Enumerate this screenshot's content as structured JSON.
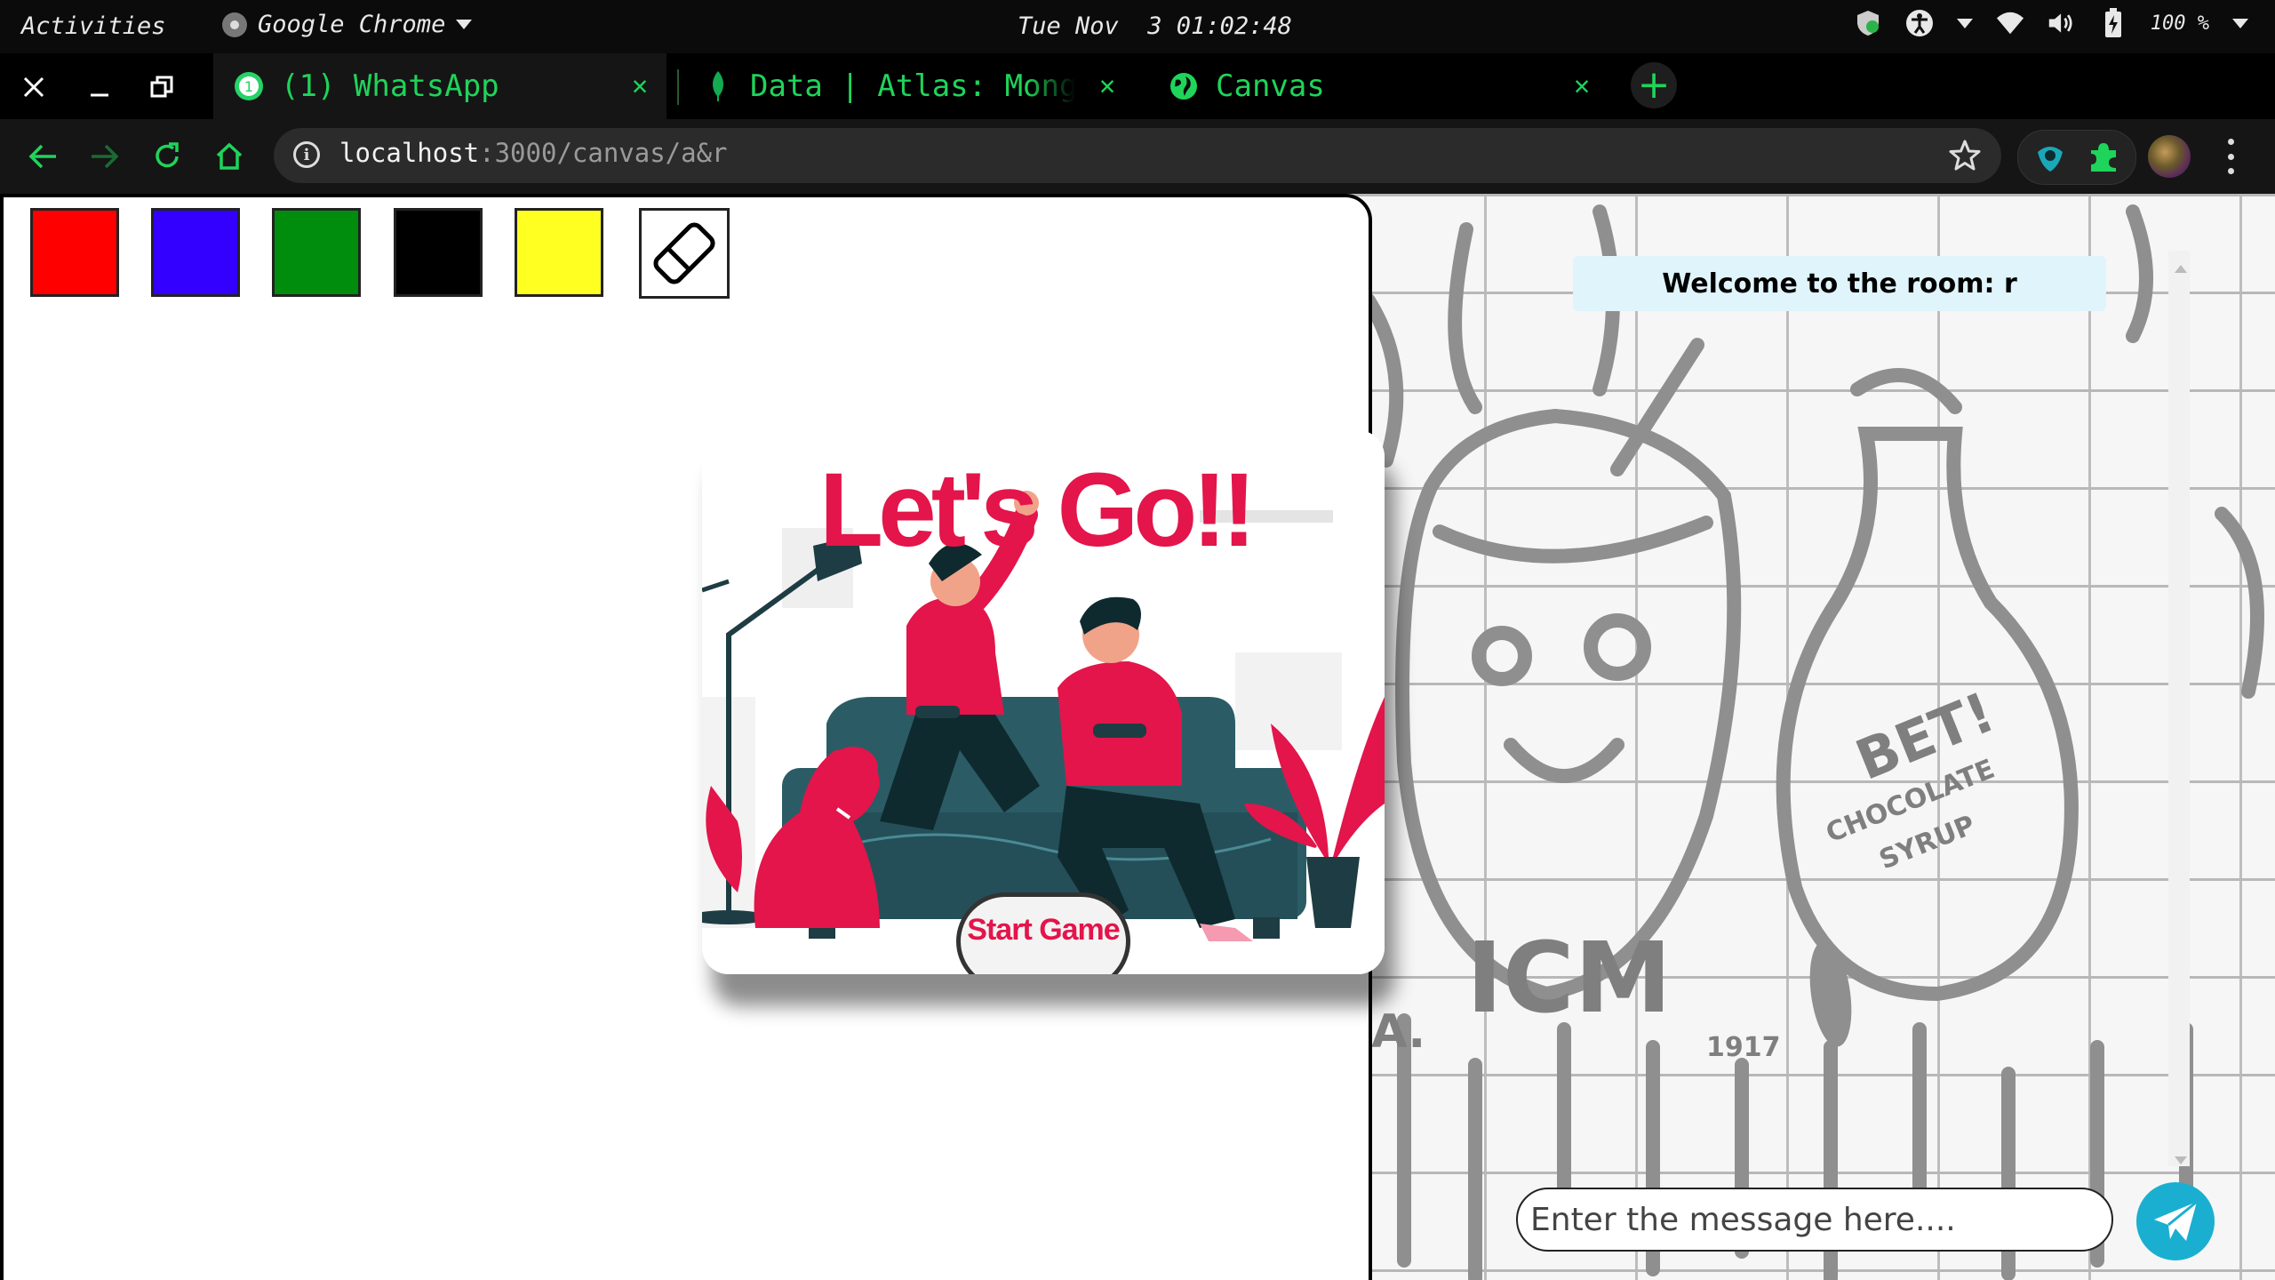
{
  "system_bar": {
    "activities": "Activities",
    "app_name": "Google Chrome",
    "clock": "Tue Nov  3 01:02:48",
    "battery_percent": "100 %"
  },
  "tabs": [
    {
      "title": "(1) WhatsApp",
      "favicon": "whatsapp-icon",
      "badge": "1",
      "active": true
    },
    {
      "title": "Data | Atlas: MongoDB",
      "favicon": "mongodb-leaf-icon",
      "active": false
    },
    {
      "title": "Canvas",
      "favicon": "globe-icon",
      "active": false
    }
  ],
  "address_bar": {
    "host": "localhost",
    "path": ":3000/canvas/a&r"
  },
  "canvas": {
    "palette": [
      {
        "name": "red",
        "color": "#ff0000"
      },
      {
        "name": "blue",
        "color": "#3300ff"
      },
      {
        "name": "green",
        "color": "#008c0c"
      },
      {
        "name": "black",
        "color": "#000000"
      },
      {
        "name": "yellow",
        "color": "#ffff22"
      }
    ],
    "eraser_icon": "eraser-icon"
  },
  "modal": {
    "headline": "Let's Go!!",
    "start_button": "Start Game"
  },
  "chat": {
    "welcome": "Welcome to the room: r",
    "input_placeholder": "Enter the message here....",
    "send_icon": "paper-plane-icon"
  },
  "wall_graffiti": {
    "bottle_text_1": "BET!",
    "bottle_text_2": "CHOCOLATE",
    "bottle_text_3": "SYRUP",
    "tag_text": "ICM",
    "year_text": "1917",
    "initials": "LA."
  },
  "colors": {
    "accent_green": "#1fd45a",
    "modal_red": "#e3154a",
    "send_blue": "#1aafd0"
  }
}
